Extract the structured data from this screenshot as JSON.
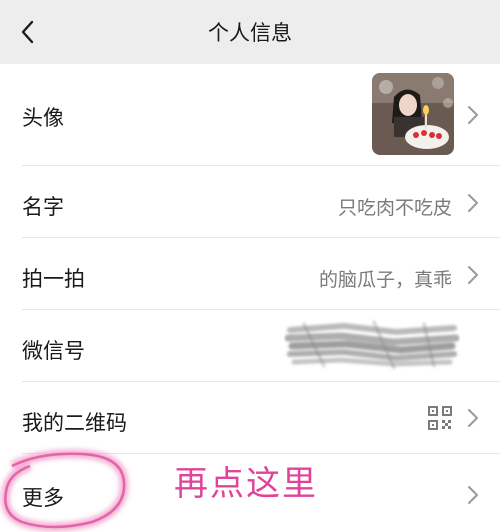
{
  "header": {
    "title": "个人信息"
  },
  "rows": [
    {
      "label": "头像"
    },
    {
      "label": "名字",
      "value": "只吃肉不吃皮"
    },
    {
      "label": "拍一拍",
      "value": "的脑瓜子，真乖"
    },
    {
      "label": "微信号"
    },
    {
      "label": "我的二维码"
    },
    {
      "label": "更多"
    }
  ],
  "annotation": {
    "text": "再点这里",
    "color": "#e0449a"
  },
  "icons": {
    "back": "chevron-left-icon",
    "chevron": "chevron-right-icon",
    "qr": "qr-code-icon"
  }
}
